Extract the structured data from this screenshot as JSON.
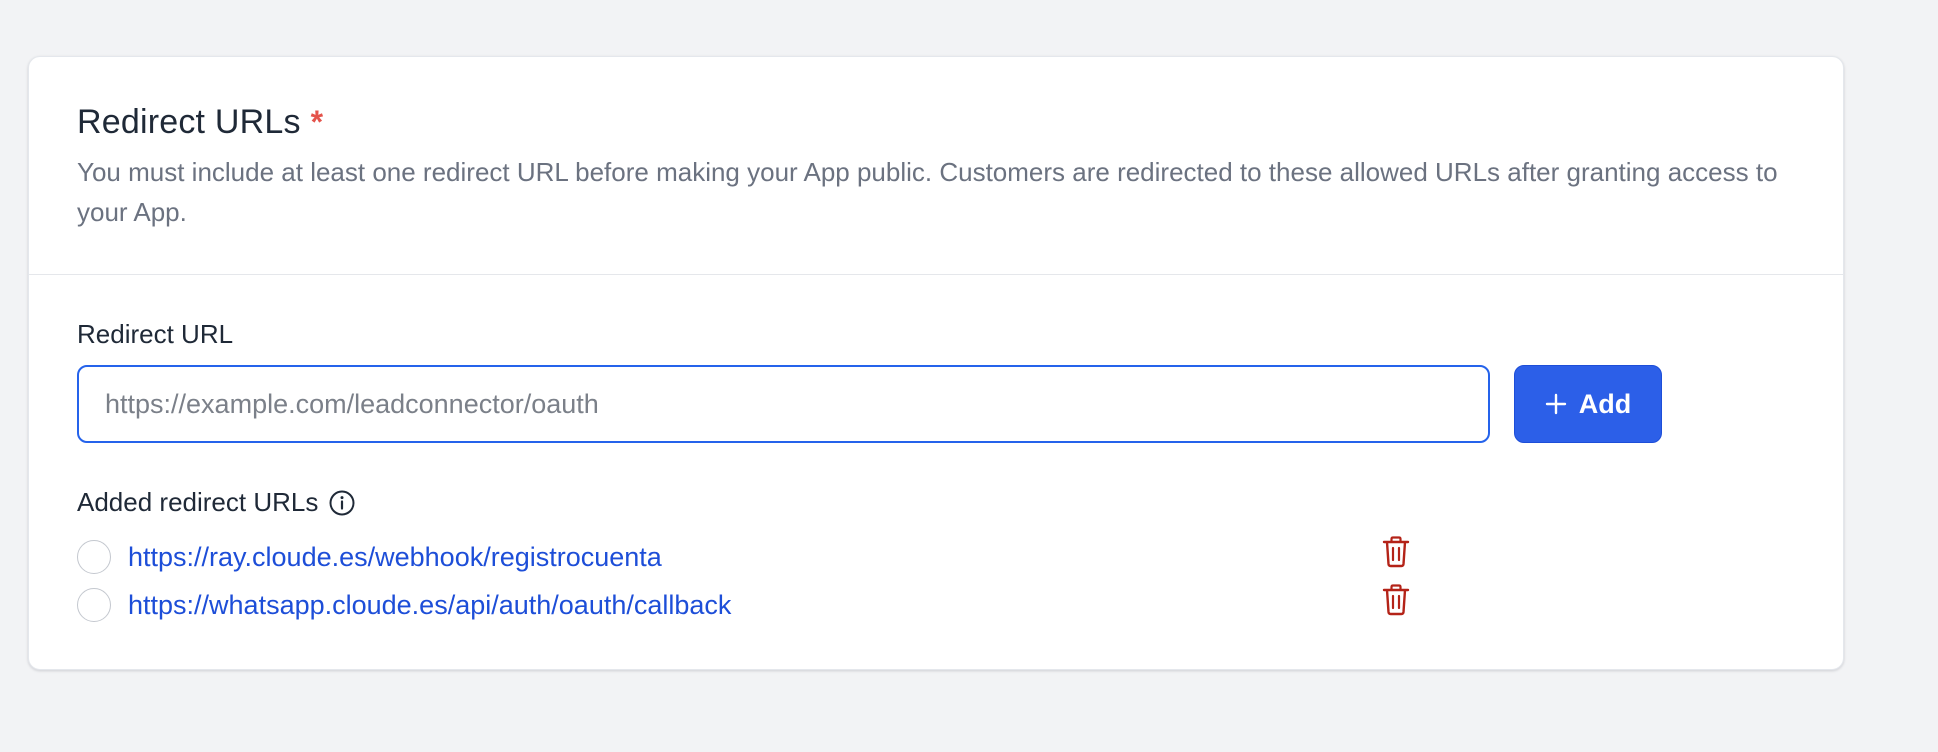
{
  "section": {
    "title": "Redirect URLs",
    "required_mark": "*",
    "description": "You must include at least one redirect URL before making your App public. Customers are redirected to these allowed URLs after granting access to your App."
  },
  "redirect_form": {
    "label": "Redirect URL",
    "input_value": "",
    "input_placeholder": "https://example.com/leadconnector/oauth",
    "add_button_label": "Add"
  },
  "added_urls": {
    "label": "Added redirect URLs",
    "items": [
      {
        "url": "https://ray.cloude.es/webhook/registrocuenta",
        "selected": false
      },
      {
        "url": "https://whatsapp.cloude.es/api/auth/oauth/callback",
        "selected": false
      }
    ]
  },
  "colors": {
    "accent": "#2c5fe8",
    "link": "#1d4ed8",
    "required": "#e4534b",
    "delete_icon": "#b42318",
    "background": "#f2f3f5"
  },
  "icons": {
    "add": "plus-icon",
    "info": "info-circle-icon",
    "delete": "trash-icon"
  }
}
